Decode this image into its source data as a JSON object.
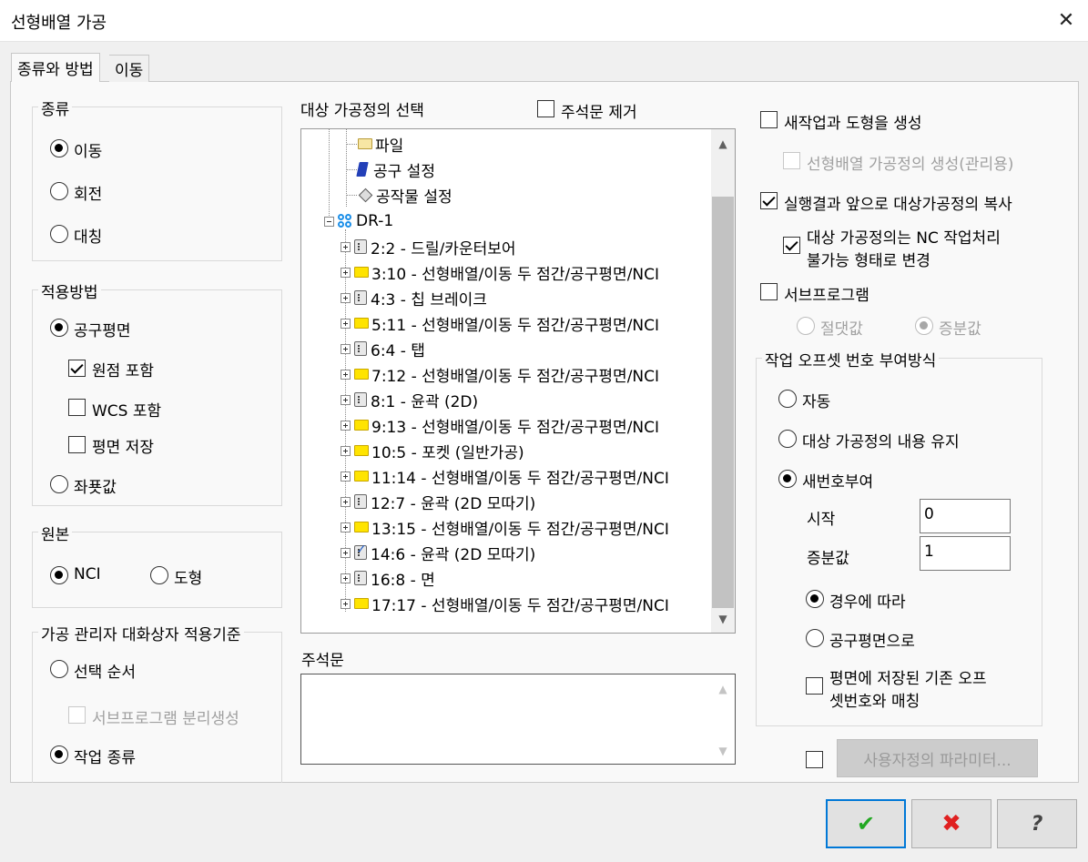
{
  "window": {
    "title": "선형배열 가공",
    "close_glyph": "✕"
  },
  "tabs": [
    {
      "label": "종류와 방법"
    },
    {
      "label": "이동"
    }
  ],
  "type_group": {
    "legend": "종류",
    "options": [
      "이동",
      "회전",
      "대칭"
    ],
    "selected": "이동"
  },
  "method_group": {
    "legend": "적용방법",
    "opt_plane": "공구평면",
    "chk_origin": "원점 포함",
    "chk_wcs": "WCS 포함",
    "chk_save_plane": "평면 저장",
    "opt_coord": "좌푯값",
    "selected": "공구평면",
    "origin_checked": true
  },
  "source_group": {
    "legend": "원본",
    "opt_nci": "NCI",
    "opt_geom": "도형",
    "selected": "NCI"
  },
  "manager_group": {
    "legend": "가공 관리자 대화상자 적용기준",
    "opt_order": "선택 순서",
    "chk_subprogram_split": "서브프로그램 분리생성",
    "opt_job_type": "작업 종류",
    "selected": "작업 종류"
  },
  "tree": {
    "label": "대상 가공정의 선택",
    "remove_comments": "주석문 제거",
    "items": [
      {
        "text": "파일",
        "icon": "folder-open-icon"
      },
      {
        "text": "공구 설정",
        "icon": "tool-icon"
      },
      {
        "text": "공작물 설정",
        "icon": "stock-diamond-icon"
      },
      {
        "text": "DR-1",
        "icon": "machine-group-icon"
      },
      {
        "text": "2:2 - 드릴/카운터보어",
        "icon": "operation-icon"
      },
      {
        "text": "3:10 - 선형배열/이동 두 점간/공구평면/NCI",
        "icon": "folder-icon"
      },
      {
        "text": "4:3 - 칩 브레이크",
        "icon": "operation-icon"
      },
      {
        "text": "5:11 - 선형배열/이동 두 점간/공구평면/NCI",
        "icon": "folder-icon"
      },
      {
        "text": "6:4 - 탭",
        "icon": "operation-icon"
      },
      {
        "text": "7:12 - 선형배열/이동 두 점간/공구평면/NCI",
        "icon": "folder-icon"
      },
      {
        "text": "8:1 - 윤곽 (2D)",
        "icon": "operation-icon"
      },
      {
        "text": "9:13 - 선형배열/이동 두 점간/공구평면/NCI",
        "icon": "folder-icon"
      },
      {
        "text": "10:5 - 포켓 (일반가공)",
        "icon": "folder-icon"
      },
      {
        "text": "11:14 - 선형배열/이동 두 점간/공구평면/NCI",
        "icon": "folder-icon"
      },
      {
        "text": "12:7 - 윤곽 (2D 모따기)",
        "icon": "operation-icon"
      },
      {
        "text": "13:15 - 선형배열/이동 두 점간/공구평면/NCI",
        "icon": "folder-icon"
      },
      {
        "text": "14:6 - 윤곽 (2D 모따기)",
        "icon": "operation-checked-icon"
      },
      {
        "text": "16:8 - 면",
        "icon": "operation-icon"
      },
      {
        "text": "17:17 - 선형배열/이동 두 점간/공구평면/NCI",
        "icon": "folder-icon"
      }
    ]
  },
  "comment": {
    "label": "주석문",
    "value": ""
  },
  "right": {
    "chk_new_op": "새작업과 도형을 생성",
    "chk_create_linear": "선형배열 가공정의 생성(관리용)",
    "chk_copy_result": "실행결과 앞으로 대상가공정의 복사",
    "chk_disable_nc_line1": "대상 가공정의는 NC 작업처리",
    "chk_disable_nc_line2": "불가능 형태로 변경",
    "chk_subprogram": "서브프로그램",
    "opt_absolute": "절댓값",
    "opt_incremental": "증분값",
    "copy_result_checked": true,
    "disable_nc_checked": true
  },
  "offset_group": {
    "legend": "작업 오프셋 번호 부여방식",
    "opt_auto": "자동",
    "opt_keep": "대상 가공정의 내용 유지",
    "opt_renumber": "새번호부여",
    "selected": "새번호부여",
    "start_label": "시작",
    "start_value": "0",
    "inc_label": "증분값",
    "inc_value": "1",
    "opt_by_case": "경우에 따라",
    "opt_by_plane": "공구평면으로",
    "chk_match_line1": "평면에 저장된 기존 오프",
    "chk_match_line2": "셋번호와 매칭"
  },
  "custom_params_button": "사용자정의 파라미터...",
  "footer": {
    "ok_icon": "checkmark-icon",
    "cancel_icon": "x-icon",
    "help_icon": "question-icon"
  },
  "colors": {
    "ok": "#22a822",
    "cancel": "#e02020",
    "accent": "#0078d7"
  }
}
